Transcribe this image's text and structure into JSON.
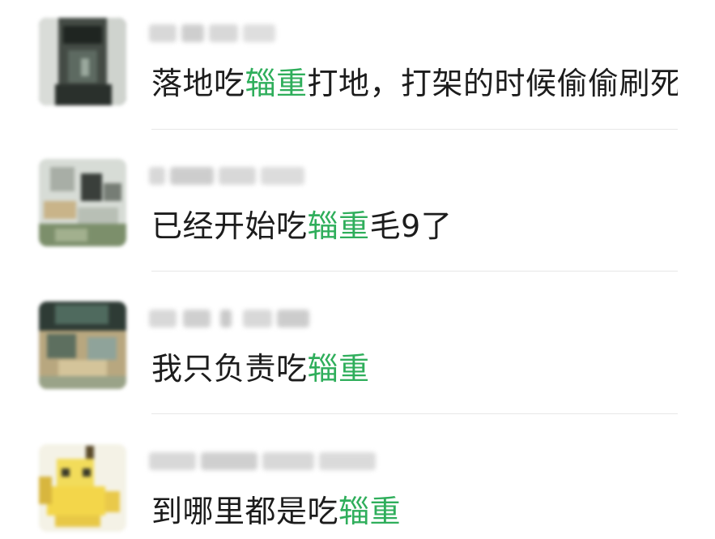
{
  "comments": [
    {
      "text_before": "落地吃",
      "keyword": "辎重",
      "text_after": "打地，打架的时候偷偷刷死",
      "avatar_icon": "blurred-photo-avatar-dark"
    },
    {
      "text_before": "已经开始吃",
      "keyword": "辎重",
      "text_after": "毛9了",
      "avatar_icon": "blurred-photo-avatar-scenery"
    },
    {
      "text_before": "我只负责吃",
      "keyword": "辎重",
      "text_after": "",
      "avatar_icon": "blurred-photo-avatar-person"
    },
    {
      "text_before": "到哪里都是吃",
      "keyword": "辎重",
      "text_after": "",
      "avatar_icon": "blurred-pikachu-avatar"
    }
  ],
  "colors": {
    "keyword": "#2fae5b",
    "text": "#1c1c1c",
    "divider": "#e7e7e7"
  }
}
